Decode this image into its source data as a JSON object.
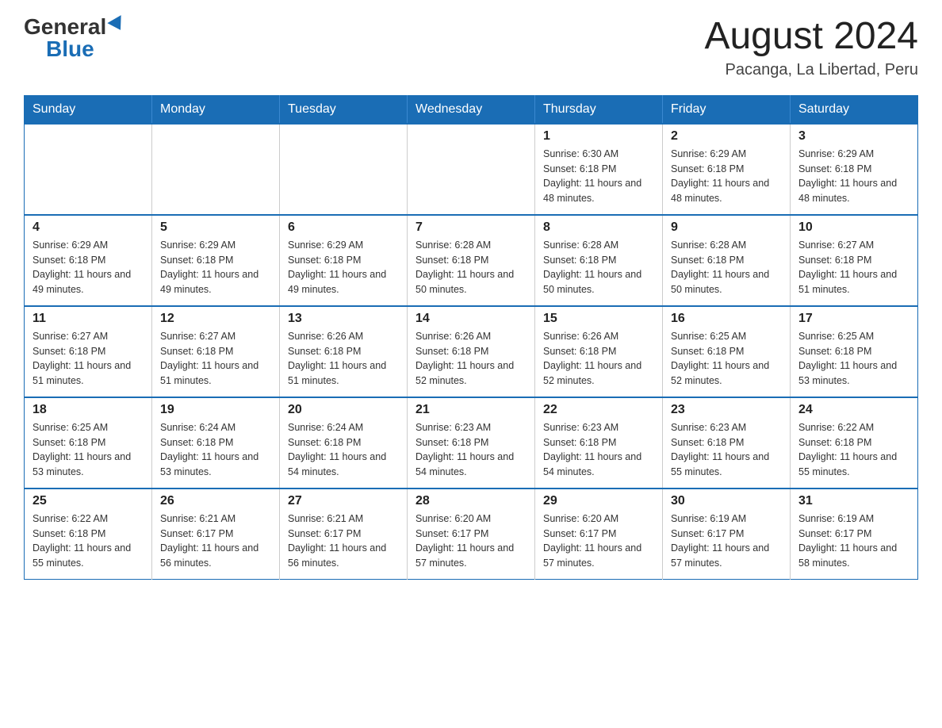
{
  "logo": {
    "general": "General",
    "blue": "Blue"
  },
  "header": {
    "month_year": "August 2024",
    "location": "Pacanga, La Libertad, Peru"
  },
  "days_of_week": [
    "Sunday",
    "Monday",
    "Tuesday",
    "Wednesday",
    "Thursday",
    "Friday",
    "Saturday"
  ],
  "weeks": [
    [
      {
        "day": "",
        "info": ""
      },
      {
        "day": "",
        "info": ""
      },
      {
        "day": "",
        "info": ""
      },
      {
        "day": "",
        "info": ""
      },
      {
        "day": "1",
        "info": "Sunrise: 6:30 AM\nSunset: 6:18 PM\nDaylight: 11 hours and 48 minutes."
      },
      {
        "day": "2",
        "info": "Sunrise: 6:29 AM\nSunset: 6:18 PM\nDaylight: 11 hours and 48 minutes."
      },
      {
        "day": "3",
        "info": "Sunrise: 6:29 AM\nSunset: 6:18 PM\nDaylight: 11 hours and 48 minutes."
      }
    ],
    [
      {
        "day": "4",
        "info": "Sunrise: 6:29 AM\nSunset: 6:18 PM\nDaylight: 11 hours and 49 minutes."
      },
      {
        "day": "5",
        "info": "Sunrise: 6:29 AM\nSunset: 6:18 PM\nDaylight: 11 hours and 49 minutes."
      },
      {
        "day": "6",
        "info": "Sunrise: 6:29 AM\nSunset: 6:18 PM\nDaylight: 11 hours and 49 minutes."
      },
      {
        "day": "7",
        "info": "Sunrise: 6:28 AM\nSunset: 6:18 PM\nDaylight: 11 hours and 50 minutes."
      },
      {
        "day": "8",
        "info": "Sunrise: 6:28 AM\nSunset: 6:18 PM\nDaylight: 11 hours and 50 minutes."
      },
      {
        "day": "9",
        "info": "Sunrise: 6:28 AM\nSunset: 6:18 PM\nDaylight: 11 hours and 50 minutes."
      },
      {
        "day": "10",
        "info": "Sunrise: 6:27 AM\nSunset: 6:18 PM\nDaylight: 11 hours and 51 minutes."
      }
    ],
    [
      {
        "day": "11",
        "info": "Sunrise: 6:27 AM\nSunset: 6:18 PM\nDaylight: 11 hours and 51 minutes."
      },
      {
        "day": "12",
        "info": "Sunrise: 6:27 AM\nSunset: 6:18 PM\nDaylight: 11 hours and 51 minutes."
      },
      {
        "day": "13",
        "info": "Sunrise: 6:26 AM\nSunset: 6:18 PM\nDaylight: 11 hours and 51 minutes."
      },
      {
        "day": "14",
        "info": "Sunrise: 6:26 AM\nSunset: 6:18 PM\nDaylight: 11 hours and 52 minutes."
      },
      {
        "day": "15",
        "info": "Sunrise: 6:26 AM\nSunset: 6:18 PM\nDaylight: 11 hours and 52 minutes."
      },
      {
        "day": "16",
        "info": "Sunrise: 6:25 AM\nSunset: 6:18 PM\nDaylight: 11 hours and 52 minutes."
      },
      {
        "day": "17",
        "info": "Sunrise: 6:25 AM\nSunset: 6:18 PM\nDaylight: 11 hours and 53 minutes."
      }
    ],
    [
      {
        "day": "18",
        "info": "Sunrise: 6:25 AM\nSunset: 6:18 PM\nDaylight: 11 hours and 53 minutes."
      },
      {
        "day": "19",
        "info": "Sunrise: 6:24 AM\nSunset: 6:18 PM\nDaylight: 11 hours and 53 minutes."
      },
      {
        "day": "20",
        "info": "Sunrise: 6:24 AM\nSunset: 6:18 PM\nDaylight: 11 hours and 54 minutes."
      },
      {
        "day": "21",
        "info": "Sunrise: 6:23 AM\nSunset: 6:18 PM\nDaylight: 11 hours and 54 minutes."
      },
      {
        "day": "22",
        "info": "Sunrise: 6:23 AM\nSunset: 6:18 PM\nDaylight: 11 hours and 54 minutes."
      },
      {
        "day": "23",
        "info": "Sunrise: 6:23 AM\nSunset: 6:18 PM\nDaylight: 11 hours and 55 minutes."
      },
      {
        "day": "24",
        "info": "Sunrise: 6:22 AM\nSunset: 6:18 PM\nDaylight: 11 hours and 55 minutes."
      }
    ],
    [
      {
        "day": "25",
        "info": "Sunrise: 6:22 AM\nSunset: 6:18 PM\nDaylight: 11 hours and 55 minutes."
      },
      {
        "day": "26",
        "info": "Sunrise: 6:21 AM\nSunset: 6:17 PM\nDaylight: 11 hours and 56 minutes."
      },
      {
        "day": "27",
        "info": "Sunrise: 6:21 AM\nSunset: 6:17 PM\nDaylight: 11 hours and 56 minutes."
      },
      {
        "day": "28",
        "info": "Sunrise: 6:20 AM\nSunset: 6:17 PM\nDaylight: 11 hours and 57 minutes."
      },
      {
        "day": "29",
        "info": "Sunrise: 6:20 AM\nSunset: 6:17 PM\nDaylight: 11 hours and 57 minutes."
      },
      {
        "day": "30",
        "info": "Sunrise: 6:19 AM\nSunset: 6:17 PM\nDaylight: 11 hours and 57 minutes."
      },
      {
        "day": "31",
        "info": "Sunrise: 6:19 AM\nSunset: 6:17 PM\nDaylight: 11 hours and 58 minutes."
      }
    ]
  ]
}
